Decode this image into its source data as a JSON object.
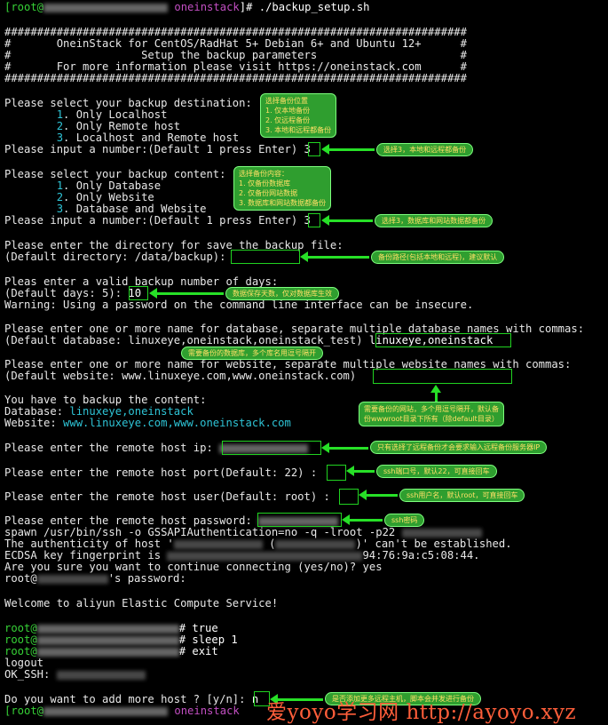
{
  "prompt_first": {
    "user_bracket": "[root@",
    "dir": "oneinstack",
    "suffix": "]# ./backup_setup.sh"
  },
  "banner": {
    "rule": "#######################################################################",
    "line1": "#       OneinStack for CentOS/RadHat 5+ Debian 6+ and Ubuntu 12+      #",
    "line2": "#                    Setup the backup parameters                      #",
    "line3": "#       For more information please visit https://oneinstack.com      #"
  },
  "destination": {
    "question": "Please select your backup destination:",
    "options": [
      {
        "num": "1",
        "text": ". Only Localhost"
      },
      {
        "num": "2",
        "text": ". Only Remote host"
      },
      {
        "num": "3",
        "text": ". Localhost and Remote host"
      }
    ],
    "input_prompt": "Please input a number:(Default 1 press Enter) ",
    "input_value": "3"
  },
  "content": {
    "question": "Please select your backup content:",
    "options": [
      {
        "num": "1",
        "text": ". Only Database"
      },
      {
        "num": "2",
        "text": ". Only Website"
      },
      {
        "num": "3",
        "text": ". Database and Website"
      }
    ],
    "input_prompt": "Please input a number:(Default 1 press Enter) ",
    "input_value": "3"
  },
  "directory": {
    "line1": "Please enter the directory for save the backup file:",
    "line2": "(Default directory: /data/backup):"
  },
  "days": {
    "line1": "Pleas enter a valid backup number of days:",
    "line2": "(Default days: 5): ",
    "value": "10",
    "warning": "Warning: Using a password on the command line interface can be insecure."
  },
  "database": {
    "line1": "Please enter one or more name for database, separate multiple database names with commas:",
    "line2": "(Default database: linuxeye,oneinstack,oneinstack_test) ",
    "value": "linuxeye,oneinstack"
  },
  "website": {
    "line1": "Please enter one or more name for website, separate multiple website names with commas:",
    "line2": "(Default website: www.linuxeye.com,www.oneinstack.com)"
  },
  "summary": {
    "line1": "You have to backup the content:",
    "db_label": "Database: ",
    "db_value": "linuxeye,oneinstack",
    "web_label": "Website: ",
    "web_value": "www.linuxeye.com,www.oneinstack.com"
  },
  "remote": {
    "ip_prompt": "Please enter the remote host ip: ",
    "port_prompt": "Please enter the remote host port(Default: 22) :",
    "user_prompt": "Please enter the remote host user(Default: root) :",
    "pass_prompt": "Please enter the remote host password: "
  },
  "ssh": {
    "spawn": "spawn /usr/bin/ssh -o GSSAPIAuthentication=no -q -lroot -p22",
    "auth1": "The authenticity of host '",
    "auth2": "' can't be established.",
    "fp1": "ECDSA key fingerprint is ",
    "fp2": "94:76:9a:c5:08:44.",
    "confirm": "Are you sure you want to continue connecting (yes/no)? yes",
    "pw": "'s password:",
    "pw_user": "root@"
  },
  "welcome": "Welcome to aliyun Elastic Compute Service!",
  "session": {
    "user": "root@",
    "cmd1": "# true",
    "cmd2": "# sleep 1",
    "cmd3": "# exit",
    "logout": "logout",
    "ok": "OK_SSH: "
  },
  "final": {
    "question": "Do you want to add more host ? [y/n]: ",
    "value": "n"
  },
  "prompt_last": {
    "user_bracket": "[root@",
    "dir": "oneinstack"
  },
  "notes": {
    "destination_box": "选择备份位置\n1. 仅本地备份\n2. 仅远程备份\n3. 本地和远程都备份",
    "destination_choice": "选择3，本地和远程都备份",
    "content_box": "选择备份内容：\n1. 仅备份数据库\n2. 仅备份网站数据\n3. 数据库和网站数据都备份",
    "content_choice": "选择3，数据库和网站数据都备份",
    "dir_note": "备份路径(包括本地和远程)，建议默认",
    "days_note": "数据保存天数，仅对数据库生效",
    "db_note": "需要备份的数据库，多个库名用逗号隔开",
    "web_note": "需要备份的网站，多个用逗号隔开，默认备\n份wwwroot目录下所有（除default目录）",
    "ip_note": "只有选择了远程备份才会要求输入远程备份服务器IP",
    "port_note": "ssh端口号，默认22，可直接回车",
    "user_note": "ssh用户名，默认root，可直接回车",
    "pass_note": "ssh密码",
    "more_note": "是否添加更多远程主机，脚本会并发进行备份"
  },
  "watermark": "爱yoyo学习网 http://ayoyo.xyz",
  "colors": {
    "prompt_green": "#36d136",
    "dir_magenta": "#c24fc2",
    "link_cyan": "#2ec4d6",
    "annotation_green": "#2f9e2f",
    "annotation_text": "#ffe066"
  }
}
